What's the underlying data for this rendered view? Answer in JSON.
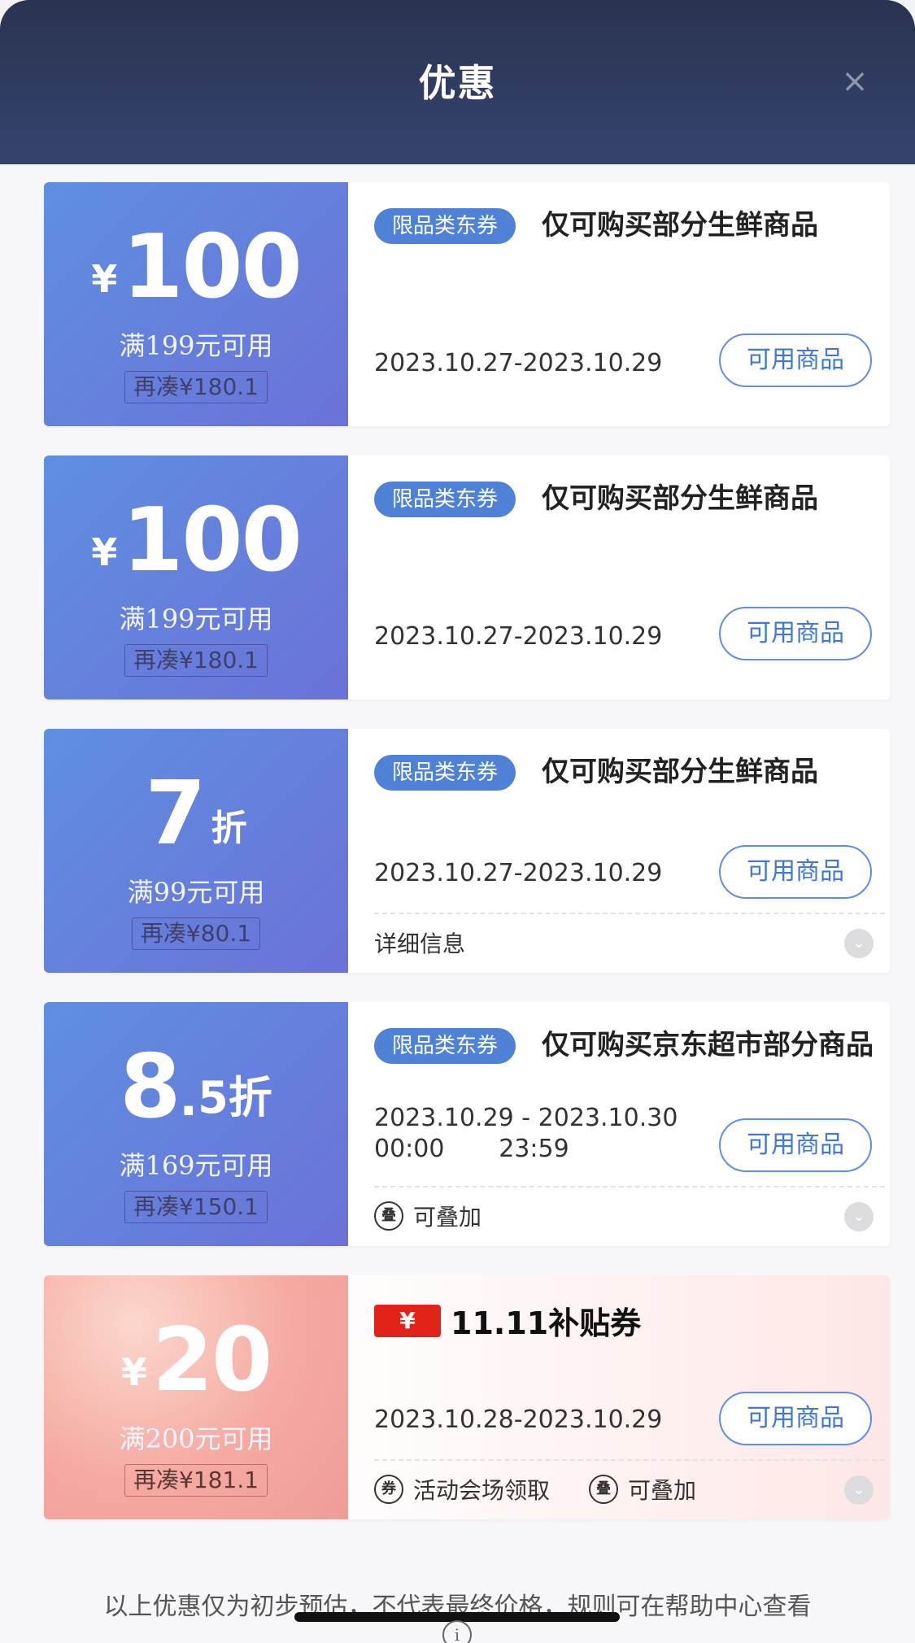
{
  "header": {
    "title": "优惠",
    "close_icon": "×"
  },
  "coupons": [
    {
      "yen": "¥",
      "amount": "100",
      "threshold": "满199元可用",
      "need": "再凑¥180.1",
      "tag": "限品类东券",
      "title": "仅可购买部分生鲜商品",
      "date": "2023.10.27-2023.10.29",
      "button": "可用商品"
    },
    {
      "yen": "¥",
      "amount": "100",
      "threshold": "满199元可用",
      "need": "再凑¥180.1",
      "tag": "限品类东券",
      "title": "仅可购买部分生鲜商品",
      "date": "2023.10.27-2023.10.29",
      "button": "可用商品"
    },
    {
      "amount": "7",
      "unit": "折",
      "threshold": "满99元可用",
      "need": "再凑¥80.1",
      "tag": "限品类东券",
      "title": "仅可购买部分生鲜商品",
      "date": "2023.10.27-2023.10.29",
      "button": "可用商品",
      "detail": "详细信息"
    },
    {
      "amount": "8",
      "dot": ".",
      "frac": "5折",
      "threshold": "满169元可用",
      "need": "再凑¥150.1",
      "tag": "限品类东券",
      "title": "仅可购买京东超市部分商品",
      "date_line1": "2023.10.29 - 2023.10.30",
      "date_line2": "00:00       23:59",
      "button": "可用商品",
      "stack": "可叠加",
      "stack_icon": "叠"
    },
    {
      "yen": "¥",
      "amount": "20",
      "threshold": "满200元可用",
      "need": "再凑¥181.1",
      "badge": "¥",
      "subtitle": "11.11补贴券",
      "date": "2023.10.28-2023.10.29",
      "button": "可用商品",
      "venue": "活动会场领取",
      "venue_icon": "券",
      "stack": "可叠加",
      "stack_icon": "叠"
    }
  ],
  "footer": {
    "note": "以上优惠仅为初步预估，不代表最终价格，规则可在帮助中心查看",
    "info": "i"
  },
  "colors": {
    "header": "#2f3a5c",
    "coupon_blue": "#6480dc",
    "button_border": "#5d8ee0",
    "badge_red": "#e2231a"
  }
}
